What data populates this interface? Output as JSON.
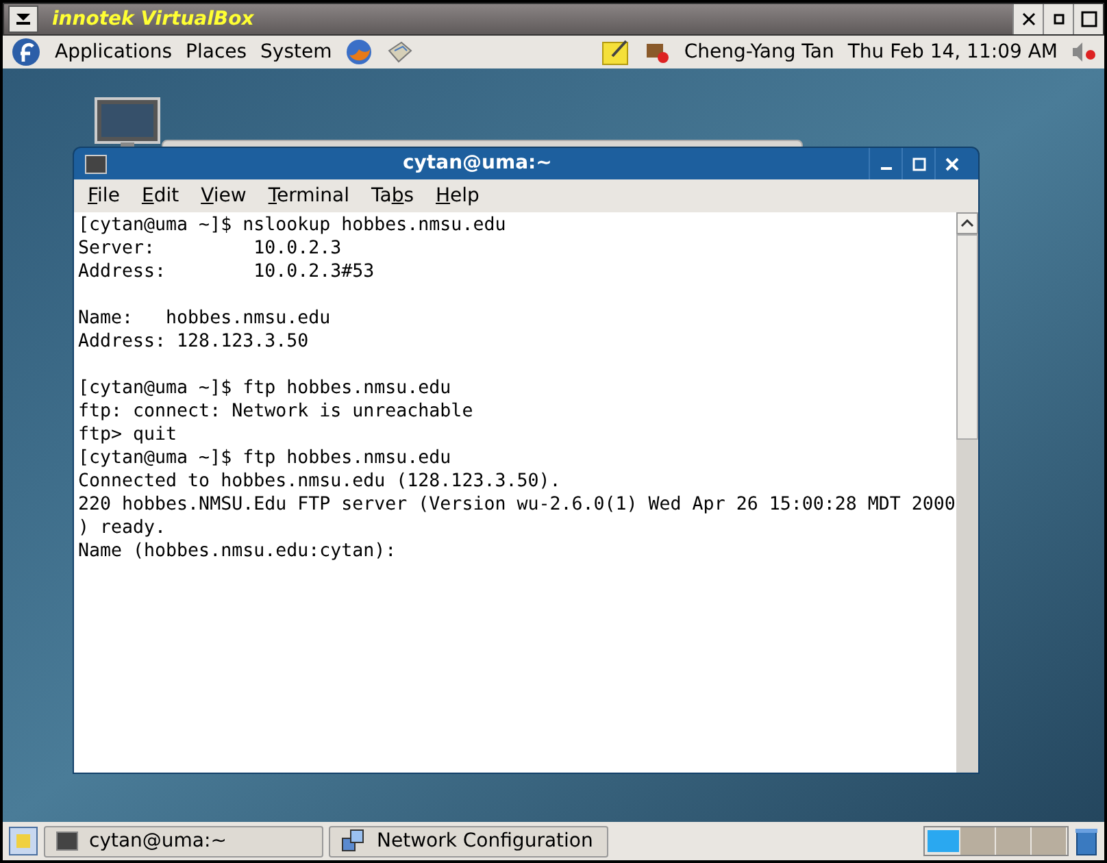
{
  "host_window": {
    "title": "innotek VirtualBox"
  },
  "top_panel": {
    "menus": [
      "Applications",
      "Places",
      "System"
    ],
    "user": "Cheng-Yang Tan",
    "clock": "Thu Feb 14, 11:09 AM"
  },
  "terminal": {
    "title": "cytan@uma:~",
    "menus": [
      {
        "key": "F",
        "post": "ile"
      },
      {
        "key": "E",
        "post": "dit"
      },
      {
        "key": "V",
        "post": "iew"
      },
      {
        "key": "T",
        "post": "erminal"
      },
      {
        "pre": "Ta",
        "key": "b",
        "post": "s"
      },
      {
        "key": "H",
        "post": "elp"
      }
    ],
    "blocks": [
      [
        "[cytan@uma ~]$ nslookup hobbes.nmsu.edu",
        "Server:         10.0.2.3",
        "Address:        10.0.2.3#53"
      ],
      [
        "Name:   hobbes.nmsu.edu",
        "Address: 128.123.3.50"
      ],
      [
        "[cytan@uma ~]$ ftp hobbes.nmsu.edu",
        "ftp: connect: Network is unreachable",
        "ftp> quit",
        "[cytan@uma ~]$ ftp hobbes.nmsu.edu",
        "Connected to hobbes.nmsu.edu (128.123.3.50).",
        "220 hobbes.NMSU.Edu FTP server (Version wu-2.6.0(1) Wed Apr 26 15:00:28 MDT 2000",
        ") ready.",
        "Name (hobbes.nmsu.edu:cytan):"
      ]
    ]
  },
  "taskbar": {
    "tasks": [
      {
        "label": "cytan@uma:~",
        "kind": "terminal",
        "selected": false
      },
      {
        "label": "Network Configuration",
        "kind": "network",
        "selected": false
      }
    ],
    "workspaces": [
      {
        "selected": true
      },
      {
        "selected": false
      },
      {
        "selected": false
      },
      {
        "selected": false
      }
    ]
  }
}
